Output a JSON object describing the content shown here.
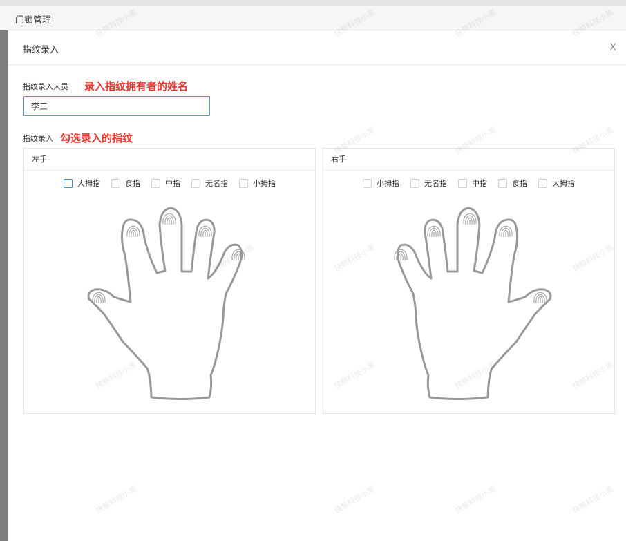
{
  "page": {
    "title": "门锁管理"
  },
  "dialog": {
    "title": "指纹录入",
    "close_label": "X",
    "person_label": "指纹录入人员",
    "person_hint": "录入指纹拥有者的姓名",
    "person_value": "李三",
    "enroll_label": "指纹录入",
    "enroll_hint": "勾选录入的指纹",
    "left_hand": {
      "title": "左手",
      "fingers": [
        "大拇指",
        "食指",
        "中指",
        "无名指",
        "小拇指"
      ]
    },
    "right_hand": {
      "title": "右手",
      "fingers": [
        "小拇指",
        "无名指",
        "中指",
        "食指",
        "大拇指"
      ]
    }
  },
  "watermark": "快鲸科技小黑"
}
